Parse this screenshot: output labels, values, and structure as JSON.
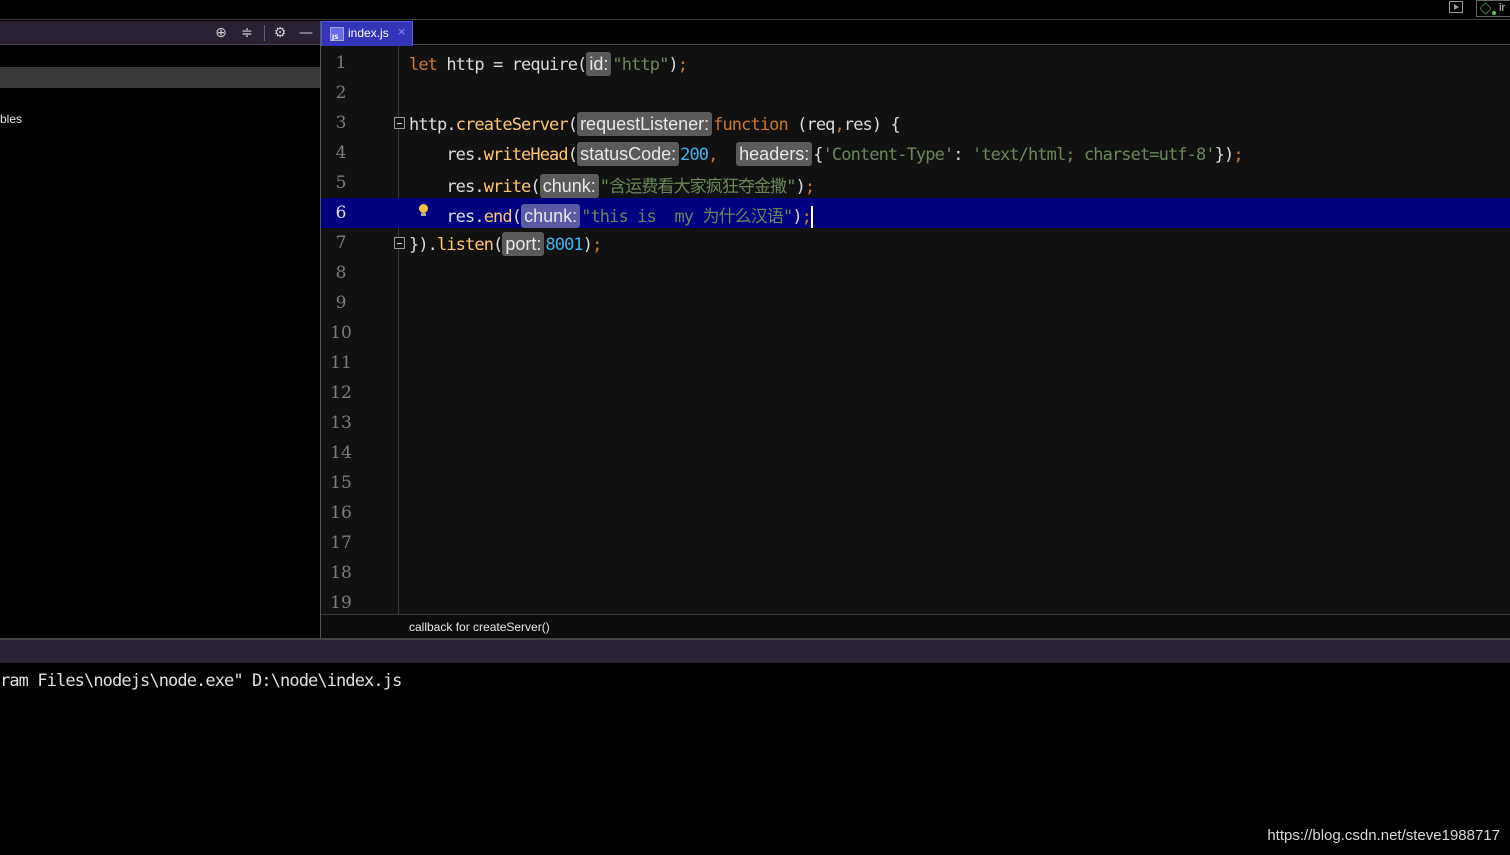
{
  "top": {
    "node_chip_text": "ir"
  },
  "left_panel": {
    "item_text": "bles"
  },
  "editor": {
    "tab": {
      "icon_text": "JS",
      "label": "index.js",
      "close": "×"
    },
    "current_line": 6,
    "line_numbers": [
      "1",
      "2",
      "3",
      "4",
      "5",
      "6",
      "7",
      "8",
      "9",
      "10",
      "11",
      "12",
      "13",
      "14",
      "15",
      "16",
      "17",
      "18",
      "19"
    ],
    "lines": {
      "l1": {
        "kw": "let",
        "text1": " http = require(",
        "hint": "id:",
        "str": "\"http\"",
        "close": ")",
        "semi": ";"
      },
      "l3": {
        "obj": "http",
        "dot": ".",
        "fn": "createServer",
        "open": "(",
        "hint": "requestListener:",
        "kw": "function",
        "params": " (req",
        "comma": ",",
        "params2": "res)",
        "brace": " {"
      },
      "l4": {
        "indent": "    ",
        "obj": "res",
        "dot": ".",
        "fn": "writeHead",
        "open": "(",
        "hint1": "statusCode:",
        "num": "200",
        "comma": ",  ",
        "hint2": "headers:",
        "lbrace": "{",
        "key": "'Content-Type'",
        "colon": ": ",
        "val": "'text/html; charset=utf-8'",
        "rbrace": "})",
        "semi": ";"
      },
      "l5": {
        "indent": "    ",
        "obj": "res",
        "dot": ".",
        "fn": "write",
        "open": "(",
        "hint": "chunk:",
        "str": "\"含运费看大家疯狂夺金撒\"",
        "close": ")",
        "semi": ";"
      },
      "l6": {
        "indent": "    ",
        "obj": "res",
        "dot": ".",
        "fn": "end",
        "open": "(",
        "hint": "chunk:",
        "str": "\"this is  my 为什么汉语\"",
        "close": ")",
        "semi": ";"
      },
      "l7": {
        "brace": "})",
        "dot": ".",
        "fn": "listen",
        "open": "(",
        "hint": "port:",
        "num": "8001",
        "close": ")",
        "semi": ";"
      }
    }
  },
  "breadcrumb": "callback for createServer()",
  "console": {
    "line": "ram Files\\nodejs\\node.exe\" D:\\node\\index.js"
  },
  "watermark": "https://blog.csdn.net/steve1988717",
  "colors": {
    "keyword": "#cc7832",
    "function": "#ffc66d",
    "string": "#6a8759",
    "number": "#3cb4f0",
    "current_line": "#000080",
    "tab_active": "#3434b8",
    "panel_header": "#2b2135"
  }
}
